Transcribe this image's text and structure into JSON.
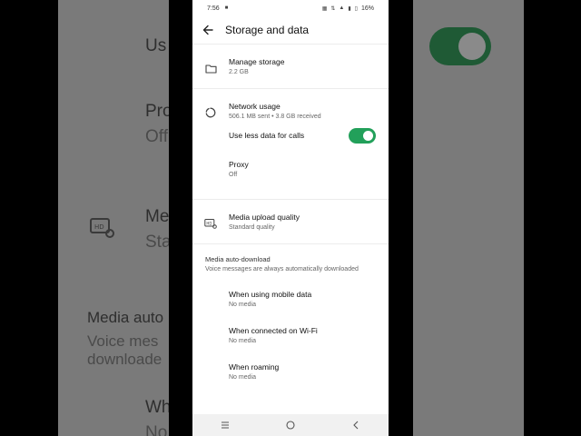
{
  "background": {
    "left_texts": [
      "Us",
      "Pro",
      "Off",
      "Me",
      "Sta",
      "Media auto",
      "Voice mes",
      "downloade",
      "Wh",
      "No"
    ]
  },
  "status_bar": {
    "time": "7:56",
    "battery": "16%"
  },
  "header": {
    "title": "Storage and data"
  },
  "items": {
    "manage_storage": {
      "title": "Manage storage",
      "subtitle": "2.2 GB"
    },
    "network_usage": {
      "title": "Network usage",
      "subtitle": "506.1 MB sent • 3.8 GB received"
    },
    "use_less_data": {
      "title": "Use less data for calls",
      "enabled": true
    },
    "proxy": {
      "title": "Proxy",
      "subtitle": "Off"
    },
    "media_upload_quality": {
      "title": "Media upload quality",
      "subtitle": "Standard quality"
    }
  },
  "auto_download": {
    "heading": "Media auto-download",
    "note": "Voice messages are always automatically downloaded",
    "mobile_data": {
      "title": "When using mobile data",
      "subtitle": "No media"
    },
    "wifi": {
      "title": "When connected on Wi-Fi",
      "subtitle": "No media"
    },
    "roaming": {
      "title": "When roaming",
      "subtitle": "No media"
    }
  },
  "colors": {
    "accent": "#22a05a",
    "text_primary": "#111111",
    "text_secondary": "#666666"
  },
  "icons": [
    "back-arrow-icon",
    "folder-icon",
    "network-usage-icon",
    "media-hd-icon",
    "recents-icon",
    "home-icon",
    "back-icon"
  ]
}
